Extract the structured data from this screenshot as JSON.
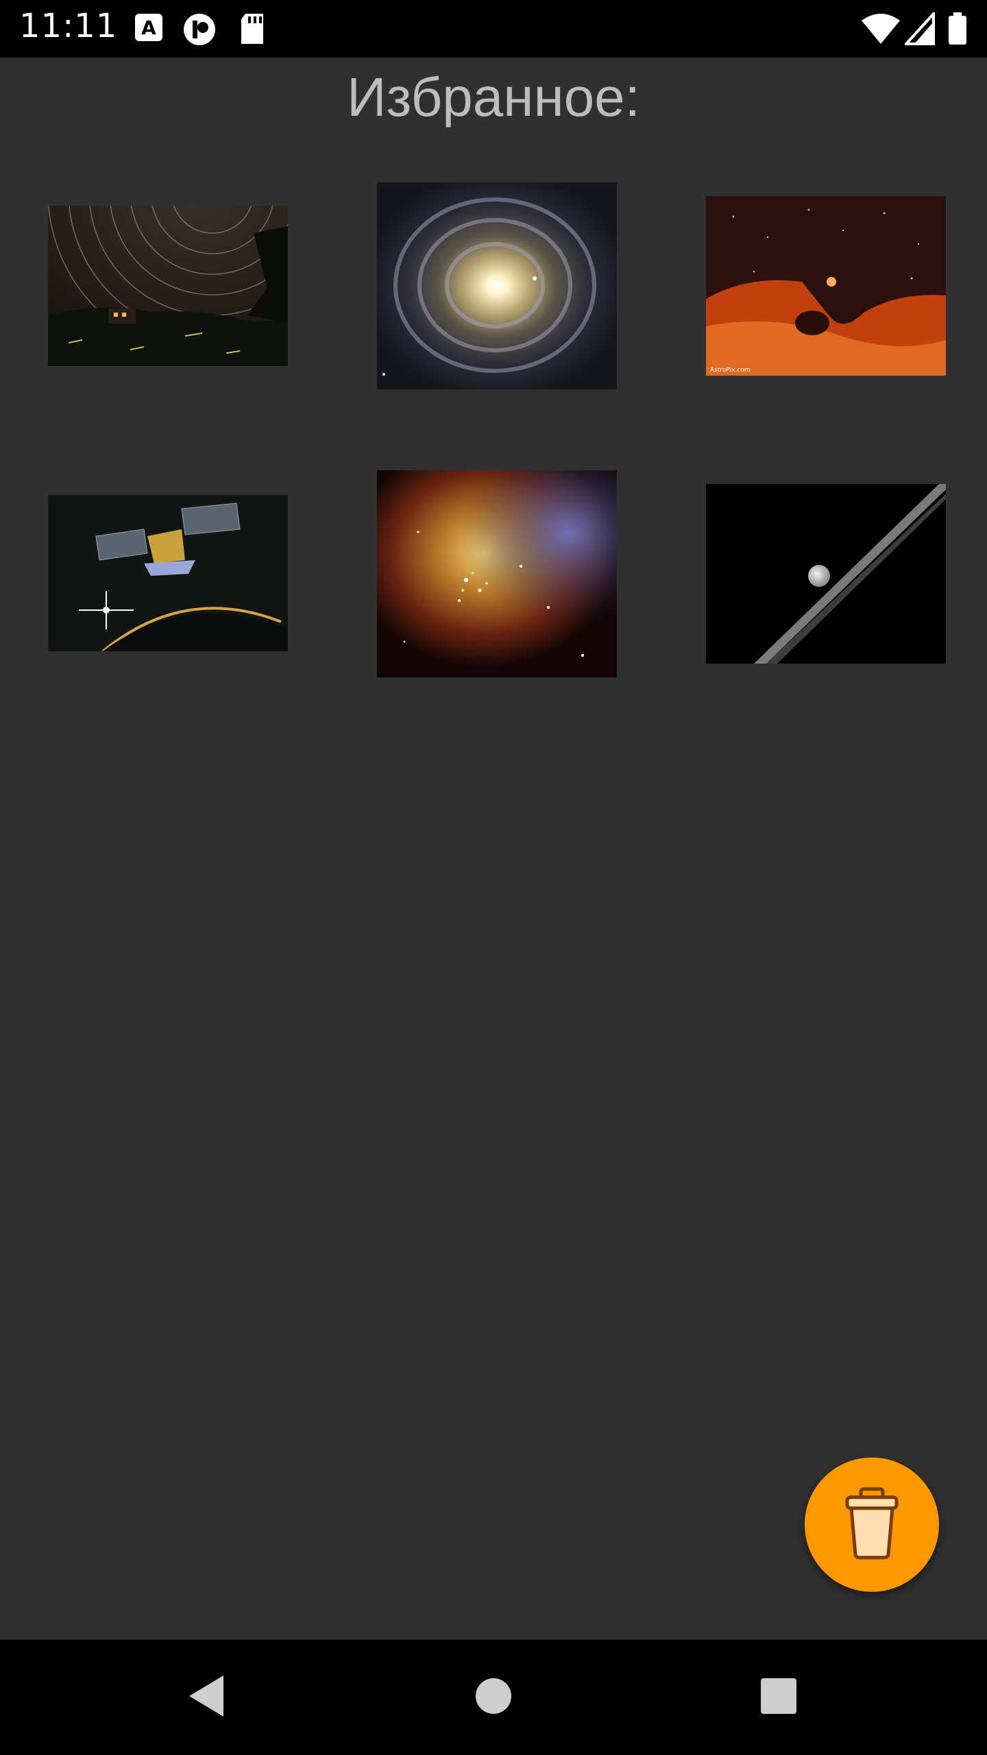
{
  "status_bar": {
    "time": "11:11",
    "icons": [
      "font-a-icon",
      "circle-p-icon",
      "sd-card-icon",
      "wifi-icon",
      "signal-icon",
      "battery-icon"
    ]
  },
  "page": {
    "title": "Избранное:"
  },
  "favorites": [
    {
      "name": "star-trails",
      "alt": "Star trails over houses at night"
    },
    {
      "name": "spiral-galaxy",
      "alt": "Spiral galaxy"
    },
    {
      "name": "red-rock-night",
      "alt": "Red rock arch under starry sky"
    },
    {
      "name": "spacecraft",
      "alt": "Spacecraft orbiting planet"
    },
    {
      "name": "nebula",
      "alt": "Colorful nebula"
    },
    {
      "name": "saturn-ring-moon",
      "alt": "Moon and planetary ring"
    }
  ],
  "fab": {
    "icon": "trash-icon",
    "color": "#ff9800"
  },
  "nav": {
    "icons": [
      "back-icon",
      "home-icon",
      "recents-icon"
    ]
  }
}
